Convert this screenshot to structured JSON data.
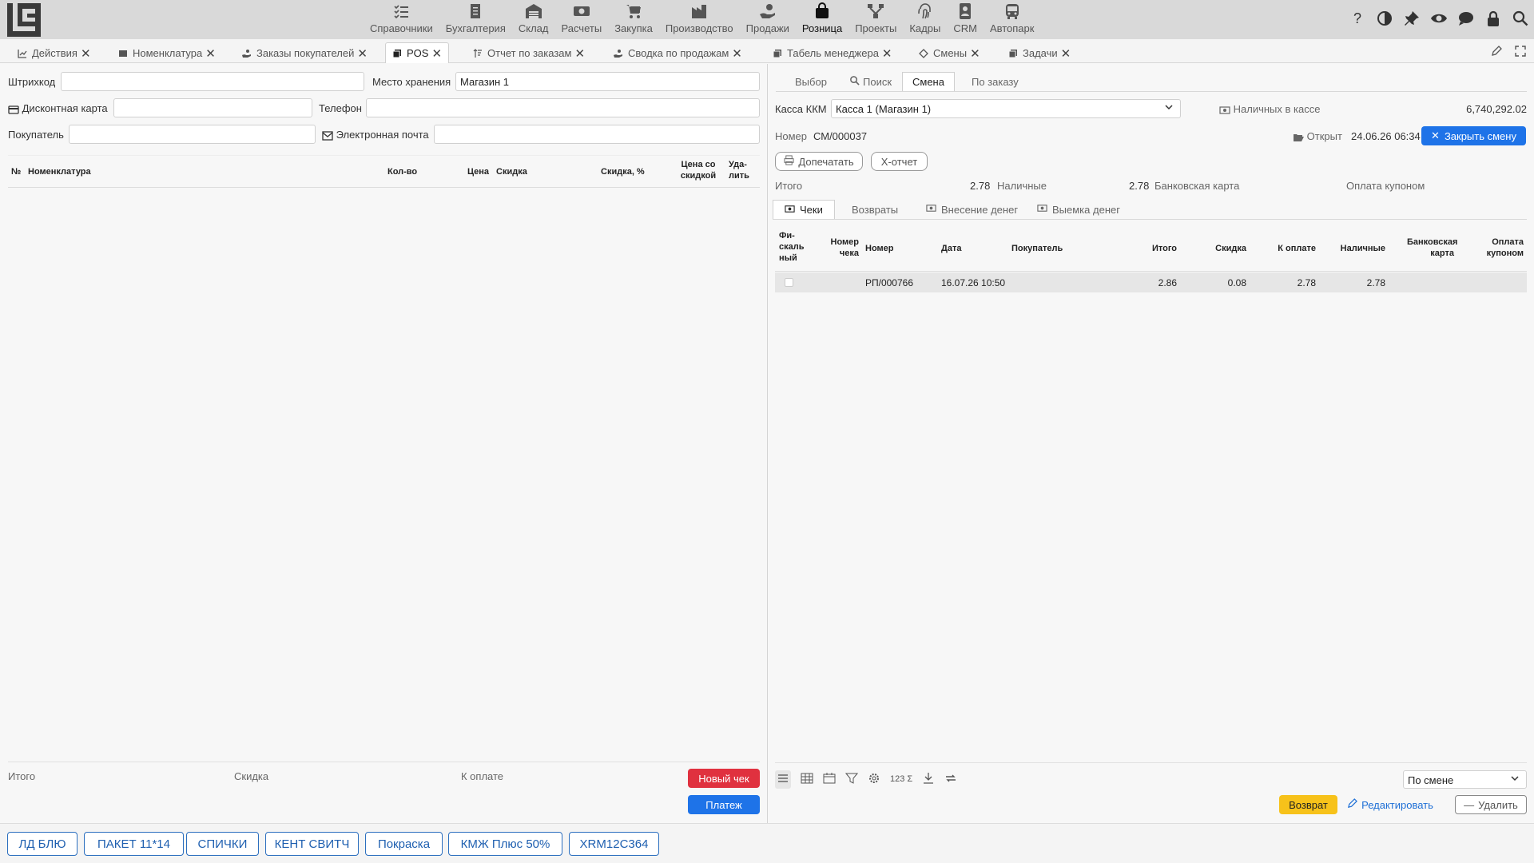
{
  "modules": [
    {
      "label": "Справочники",
      "icon": "list-check-icon"
    },
    {
      "label": "Бухгалтерия",
      "icon": "ledger-icon"
    },
    {
      "label": "Склад",
      "icon": "warehouse-icon"
    },
    {
      "label": "Расчеты",
      "icon": "money-icon"
    },
    {
      "label": "Закупка",
      "icon": "cart-icon"
    },
    {
      "label": "Производство",
      "icon": "factory-icon"
    },
    {
      "label": "Продажи",
      "icon": "hand-coin-icon"
    },
    {
      "label": "Розница",
      "icon": "shopping-bag-icon",
      "active": true
    },
    {
      "label": "Проекты",
      "icon": "network-icon"
    },
    {
      "label": "Кадры",
      "icon": "fingerprint-icon"
    },
    {
      "label": "CRM",
      "icon": "contact-icon"
    },
    {
      "label": "Автопарк",
      "icon": "bus-icon"
    }
  ],
  "tabs": [
    {
      "label": "Действия",
      "icon": "chart-icon"
    },
    {
      "label": "Номенклатура",
      "icon": "catalog-icon"
    },
    {
      "label": "Заказы покупателей",
      "icon": "hand-icon"
    },
    {
      "label": "POS",
      "icon": "copy-icon",
      "active": true
    },
    {
      "label": "Отчет по заказам",
      "icon": "sort-icon"
    },
    {
      "label": "Сводка по продажам",
      "icon": "hand-icon"
    },
    {
      "label": "Табель менеджера",
      "icon": "copy-icon"
    },
    {
      "label": "Смены",
      "icon": "diamond-icon"
    },
    {
      "label": "Задачи",
      "icon": "copy-icon"
    }
  ],
  "left": {
    "barcode_label": "Штрихкод",
    "storage_label": "Место хранения",
    "storage_value": "Магазин 1",
    "discount_card_label": "Дисконтная карта",
    "phone_label": "Телефон",
    "buyer_label": "Покупатель",
    "email_label": "Электронная почта",
    "columns": {
      "num": "№",
      "item": "Номенклатура",
      "qty": "Кол-во",
      "price": "Цена",
      "discount": "Скидка",
      "discount_pct": "Скидка, %",
      "price_disc": "Цена со скидкой",
      "delete": "Уда-лить"
    },
    "total_label": "Итого",
    "discount_label": "Скидка",
    "to_pay_label": "К оплате",
    "new_check_btn": "Новый чек",
    "payment_btn": "Платеж"
  },
  "right": {
    "subtabs": [
      "Выбор",
      "Поиск",
      "Смена",
      "По заказу"
    ],
    "active_subtab": "Смена",
    "kkm_label": "Касса ККМ",
    "kkm_value": "Касса 1 (Магазин 1)",
    "cash_label": "Наличных в кассе",
    "cash_value": "6,740,292.02",
    "number_label": "Номер",
    "number_value": "СМ/000037",
    "opened_label": "Открыт",
    "opened_value": "24.06.26 06:34",
    "close_shift_btn": "Закрыть смену",
    "reprint_btn": "Допечатать",
    "xreport_btn": "X-отчет",
    "summary": {
      "total_label": "Итого",
      "total_value": "2.78",
      "cash_label": "Наличные",
      "cash_value": "2.78",
      "card_label": "Банковская карта",
      "coupon_label": "Оплата купоном"
    },
    "doc_tabs": [
      "Чеки",
      "Возвраты",
      "Внесение денег",
      "Выемка денег"
    ],
    "columns": {
      "fiscal": "Фи-скаль ный",
      "check_no": "Номер чека",
      "number": "Номер",
      "date": "Дата",
      "buyer": "Покупатель",
      "total": "Итого",
      "discount": "Скидка",
      "to_pay": "К оплате",
      "cash": "Наличные",
      "card": "Банковская карта",
      "coupon": "Оплата купоном"
    },
    "rows": [
      {
        "check_no": "",
        "number": "РП/000766",
        "date": "16.07.26 10:50",
        "buyer": "",
        "total": "2.86",
        "discount": "0.08",
        "to_pay": "2.78",
        "cash": "2.78",
        "card": "",
        "coupon": ""
      }
    ],
    "filter_value": "По смене",
    "return_btn": "Возврат",
    "edit_btn": "Редактировать",
    "delete_btn": "Удалить"
  },
  "quick_buttons": [
    "ЛД БЛЮ",
    "ПАКЕТ 11*14",
    "СПИЧКИ",
    "КЕНТ СВИТЧ",
    "Покраска",
    "КМЖ Плюс 50%",
    "XRM12C364"
  ]
}
